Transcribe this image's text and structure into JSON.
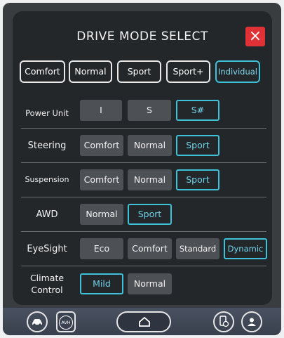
{
  "title": "DRIVE MODE SELECT",
  "close_label": "×",
  "modes": [
    "Comfort",
    "Normal",
    "Sport",
    "Sport+",
    "Individual"
  ],
  "active_mode": "Individual",
  "rows": [
    {
      "label": "Power Unit",
      "options": [
        "I",
        "S",
        "S#"
      ],
      "active": "S#"
    },
    {
      "label": "Steering",
      "options": [
        "Comfort",
        "Normal",
        "Sport"
      ],
      "active": "Sport"
    },
    {
      "label": "Suspension",
      "options": [
        "Comfort",
        "Normal",
        "Sport"
      ],
      "active": "Sport"
    },
    {
      "label": "AWD",
      "options": [
        "Normal",
        "Sport"
      ],
      "active": "Sport"
    },
    {
      "label": "EyeSight",
      "options": [
        "Eco",
        "Comfort",
        "Standard",
        "Dynamic"
      ],
      "active": "Dynamic"
    },
    {
      "label_line1": "Climate",
      "label_line2": "Control",
      "options": [
        "Mild",
        "Normal"
      ],
      "active": "Mild"
    }
  ],
  "bottom": {
    "avh_label": "AVH"
  },
  "colors": {
    "accent": "#3fc1d9",
    "close": "#e03236",
    "panel": "#24272a",
    "option_bg": "#4d5054"
  }
}
